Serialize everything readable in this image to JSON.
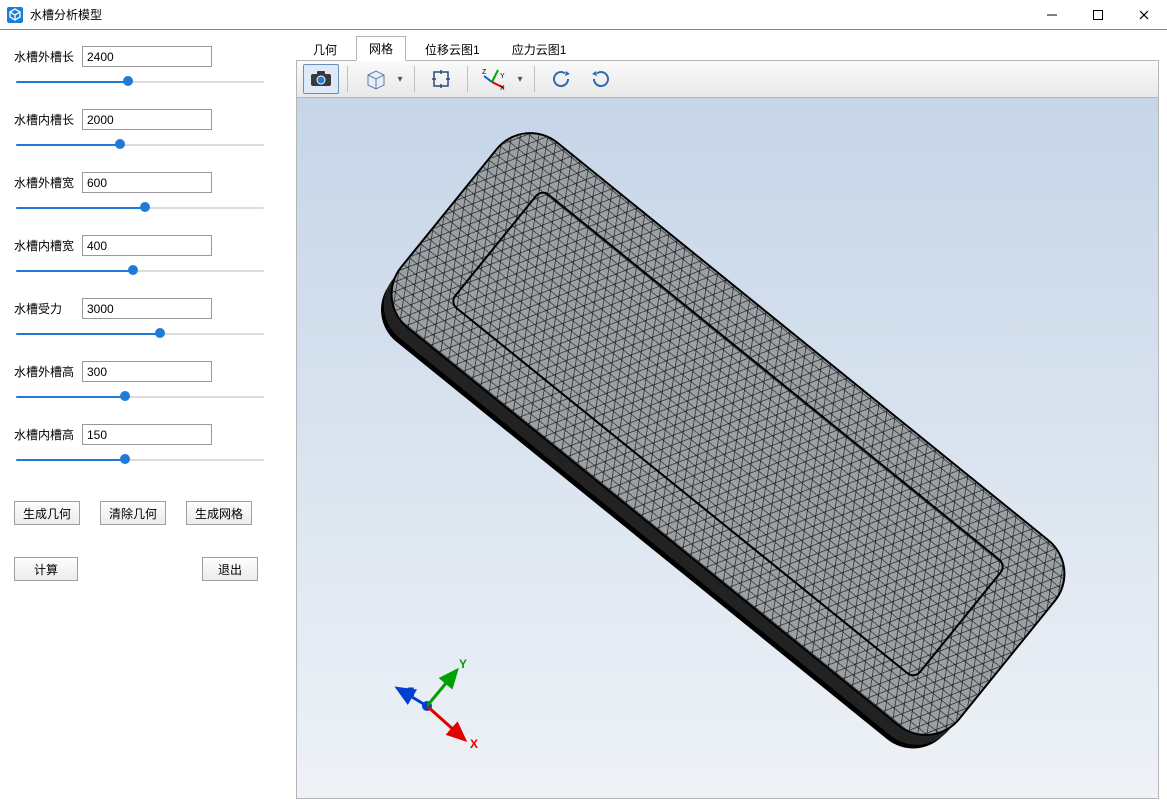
{
  "window": {
    "title": "水槽分析模型",
    "buttons": {
      "min": "–",
      "max": "□",
      "close": "✕"
    }
  },
  "params": [
    {
      "label": "水槽外槽长",
      "value": "2400",
      "pct": 45
    },
    {
      "label": "水槽内槽长",
      "value": "2000",
      "pct": 42
    },
    {
      "label": "水槽外槽宽",
      "value": "600",
      "pct": 52
    },
    {
      "label": "水槽内槽宽",
      "value": "400",
      "pct": 47
    },
    {
      "label": "水槽受力",
      "value": "3000",
      "pct": 58
    },
    {
      "label": "水槽外槽高",
      "value": "300",
      "pct": 44
    },
    {
      "label": "水槽内槽高",
      "value": "150",
      "pct": 44
    }
  ],
  "buttons": {
    "gen_geom": "生成几何",
    "clear_geom": "清除几何",
    "gen_mesh": "生成网格",
    "calc": "计算",
    "exit": "退出"
  },
  "tabs": [
    {
      "label": "几何",
      "active": false
    },
    {
      "label": "网格",
      "active": true
    },
    {
      "label": "位移云图1",
      "active": false
    },
    {
      "label": "应力云图1",
      "active": false
    }
  ],
  "toolbar": {
    "screenshot": "screenshot-icon",
    "viewcube": "viewcube-icon",
    "fit": "fit-view-icon",
    "orient": "axes-orient-icon",
    "rotccw": "rotate-ccw-icon",
    "rotcw": "rotate-cw-icon"
  },
  "axes": {
    "x": "X",
    "y": "Y",
    "z": "Z"
  }
}
